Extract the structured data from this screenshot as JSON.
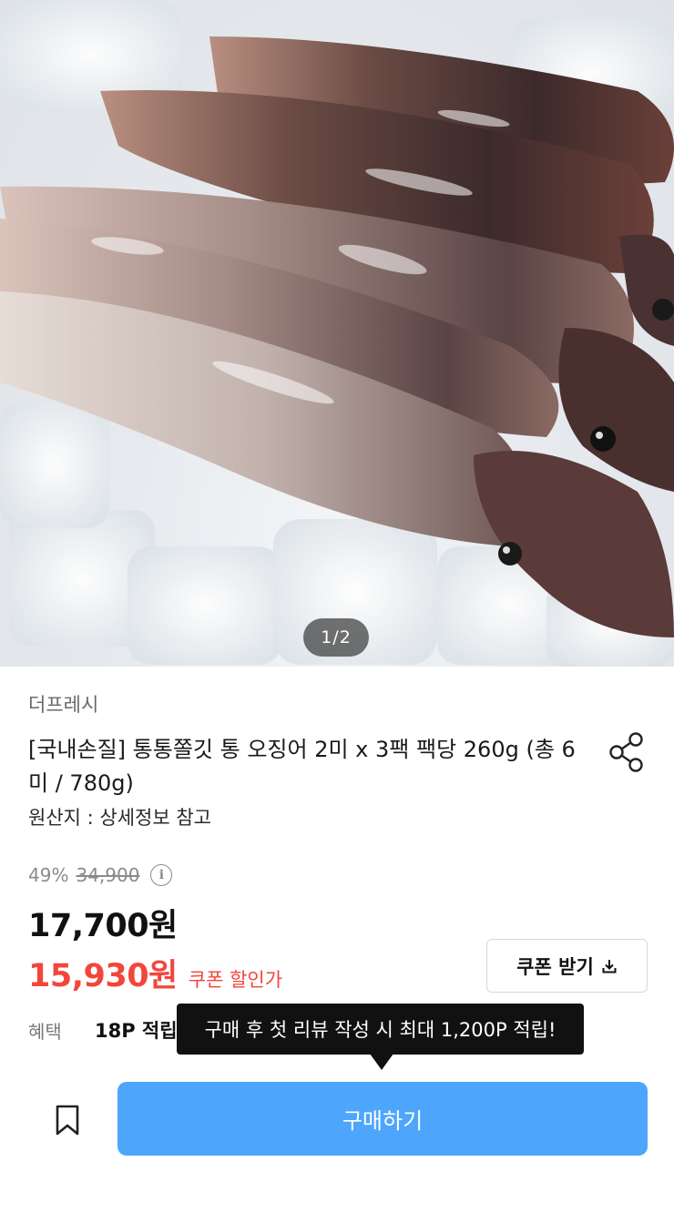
{
  "gallery": {
    "image_subject": "squid on ice",
    "counter": "1/2"
  },
  "product": {
    "brand": "더프레시",
    "title": "[국내손질] 통통쫄깃 통 오징어 2미 x 3팩 팩당 260g (총 6미 / 780g)",
    "origin": "원산지 : 상세정보 참고"
  },
  "pricing": {
    "discount_rate": "49%",
    "original_price": "34,900",
    "price": "17,700원",
    "coupon_price": "15,930원",
    "coupon_label": "쿠폰 할인가",
    "coupon_button": "쿠폰 받기"
  },
  "benefit": {
    "label": "혜택",
    "value": "18P 적립",
    "tooltip": "구매 후 첫 리뷰 작성 시 최대 1,200P 적립!"
  },
  "actions": {
    "buy_label": "구매하기"
  },
  "colors": {
    "accent_red": "#f2463c",
    "buy_blue": "#4da6fb"
  },
  "icons": {
    "share": "share-icon",
    "info": "info-icon",
    "download": "download-icon",
    "bookmark": "bookmark-icon"
  }
}
